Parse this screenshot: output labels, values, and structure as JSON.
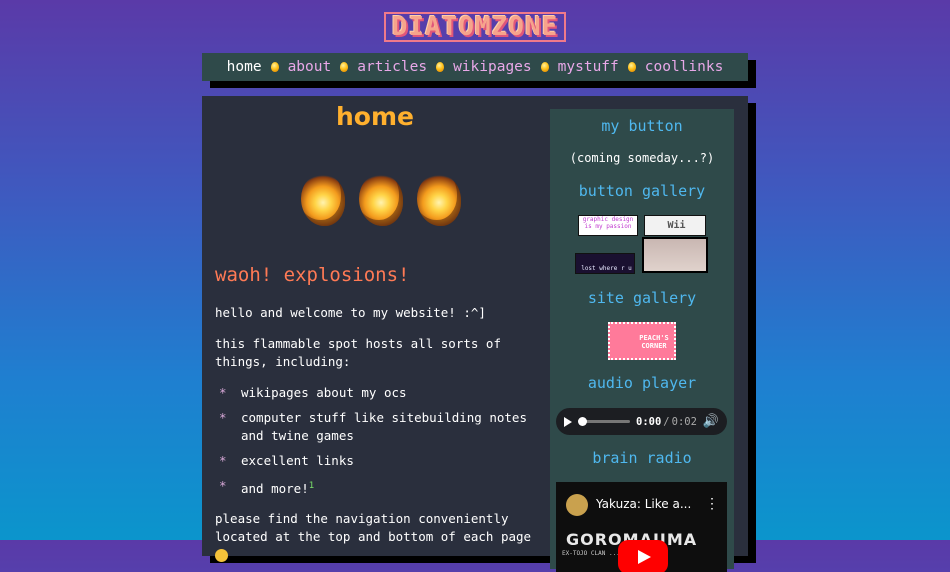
{
  "site": {
    "logo": "DIATOMZONE"
  },
  "nav": {
    "items": [
      {
        "label": "home"
      },
      {
        "label": "about"
      },
      {
        "label": "articles"
      },
      {
        "label": "wikipages"
      },
      {
        "label": "mystuff"
      },
      {
        "label": "coollinks"
      }
    ]
  },
  "main": {
    "title": "home",
    "section_heading": "waoh! explosions!",
    "intro": "hello and welcome to my website! :^]",
    "hosts": "this flammable spot hosts all sorts of things, including:",
    "list": [
      {
        "text": "wikipages about my ocs"
      },
      {
        "text": "computer stuff like sitebuilding notes and twine games"
      },
      {
        "text": "excellent links"
      },
      {
        "text": "and more!",
        "footnote": "1"
      }
    ],
    "bullet_symbol": "*",
    "navigation_note": "please find the navigation conveniently located at the top and bottom of each page"
  },
  "sidebar": {
    "my_button_heading": "my button",
    "coming_soon": "(coming someday...?)",
    "button_gallery_heading": "button gallery",
    "buttons": [
      {
        "text": "graphic design is my passion"
      },
      {
        "text": "Wii"
      },
      {
        "text": "lost where r u"
      },
      {
        "text": ""
      }
    ],
    "site_gallery_heading": "site gallery",
    "site_button": "PEACH'S CORNER",
    "audio_heading": "audio player",
    "audio": {
      "current": "0:00",
      "separator": "/",
      "duration": "0:02",
      "progress": 0
    },
    "radio_heading": "brain radio",
    "video": {
      "title": "Yakuza: Like a...",
      "banner": "GOROMAJIMA",
      "subtitle": "EX-TOJO CLAN ... ADVISOR"
    }
  },
  "colors": {
    "accent_orange": "#ffb02e",
    "heading_red": "#ff7a55",
    "sidebar_heading": "#4fb8ef",
    "nav_link": "#e8a8e8",
    "panel_bg": "#2a2f3d",
    "sidebar_bg": "#2f4a4a"
  },
  "icons": [
    "flame-dot-icon",
    "explosion-icon",
    "play-icon",
    "volume-icon",
    "youtube-play-icon",
    "more-options-icon"
  ]
}
